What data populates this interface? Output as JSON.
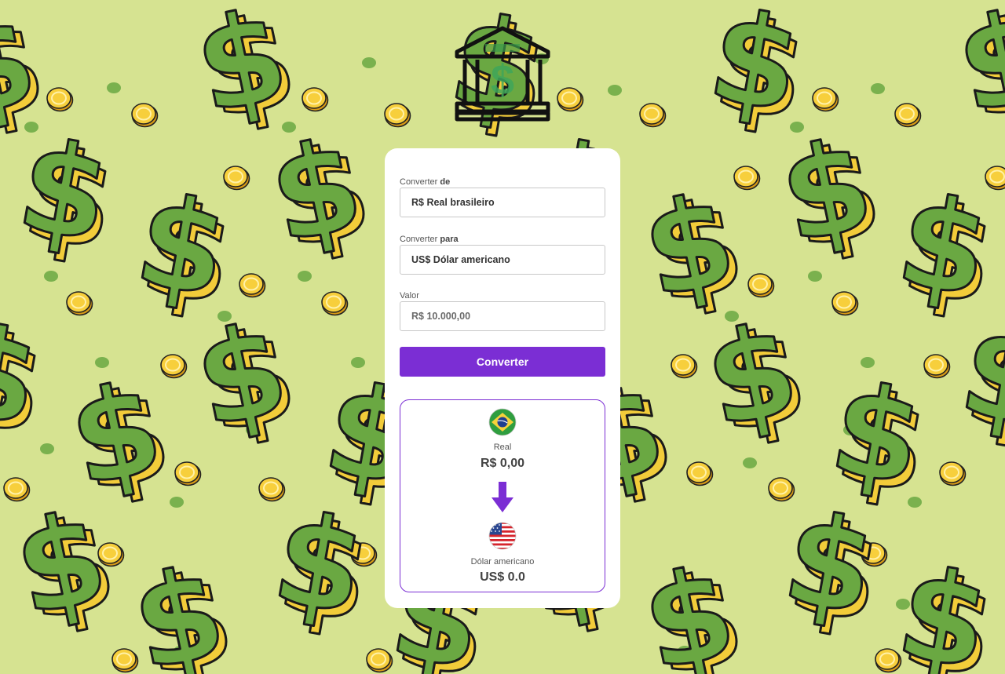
{
  "colors": {
    "background": "#d6e391",
    "accent": "#7b2ed4",
    "dollar_green": "#6aa842",
    "dollar_yellow": "#f2cc3a",
    "card": "#ffffff"
  },
  "logo": {
    "icon": "bank-dollar-icon"
  },
  "form": {
    "from_label_prefix": "Converter",
    "from_label_bold": "de",
    "from_value": "R$ Real brasileiro",
    "to_label_prefix": "Converter",
    "to_label_bold": "para",
    "to_value": "US$ Dólar americano",
    "amount_label": "Valor",
    "amount_placeholder": "R$ 10.000,00",
    "convert_label": "Converter"
  },
  "result": {
    "from": {
      "flag": "brazil-flag-icon",
      "name": "Real",
      "value": "R$ 0,00"
    },
    "arrow": "arrow-down-icon",
    "to": {
      "flag": "usa-flag-icon",
      "name": "Dólar americano",
      "value": "US$ 0.0"
    }
  }
}
